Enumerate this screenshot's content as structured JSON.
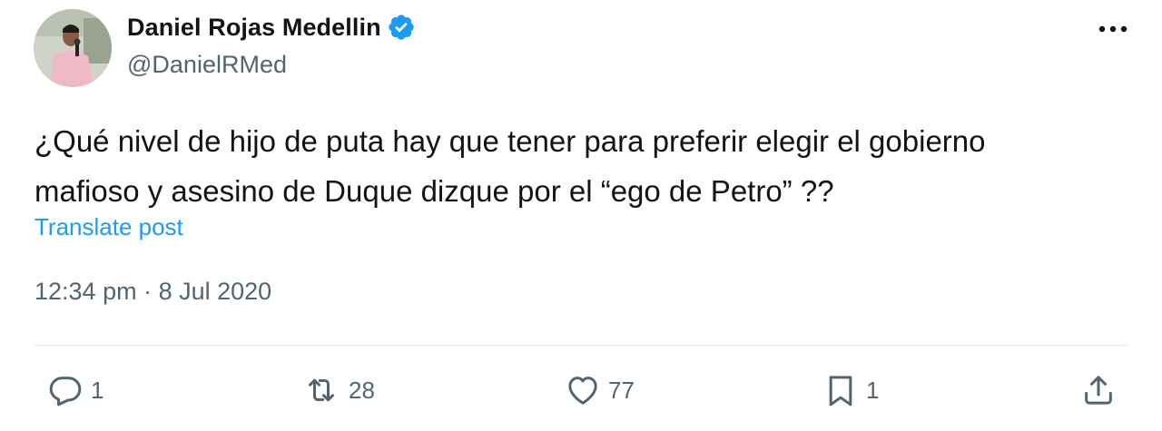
{
  "author": {
    "name": "Daniel Rojas Medellin",
    "handle": "@DanielRMed",
    "verified": true
  },
  "tweet": {
    "line1": "¿Qué nivel de hijo de puta hay que tener para preferir elegir el gobierno",
    "line2": "mafioso y asesino de Duque dizque por el “ego de Petro” ??",
    "translate_label": "Translate post",
    "timestamp": "12:34 pm · 8 Jul 2020"
  },
  "metrics": {
    "replies": "1",
    "reposts": "28",
    "likes": "77",
    "bookmarks": "1"
  },
  "colors": {
    "verified_badge": "#1d9bf0",
    "link": "#1d9bf0",
    "secondary_text": "#536471"
  }
}
